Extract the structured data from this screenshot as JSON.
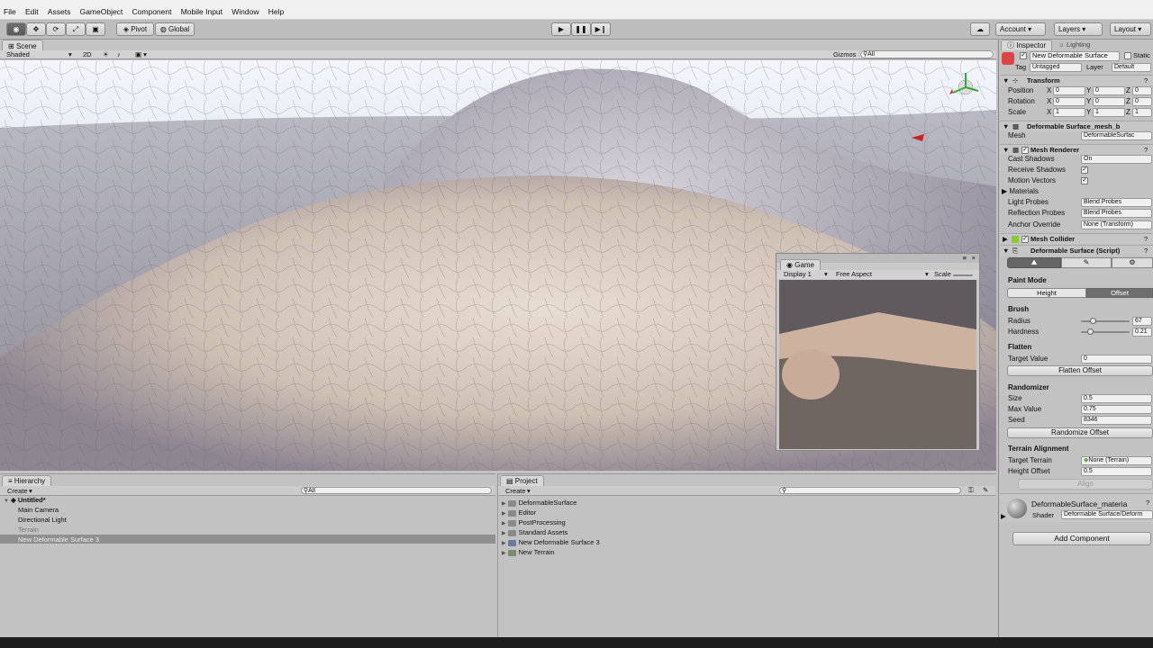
{
  "menu": [
    "File",
    "Edit",
    "Assets",
    "GameObject",
    "Component",
    "Mobile Input",
    "Window",
    "Help"
  ],
  "toolbar": {
    "pivot": "Pivot",
    "global": "Global",
    "account": "Account",
    "layers": "Layers",
    "layout": "Layout"
  },
  "scene": {
    "tab": "Scene",
    "shading": "Shaded",
    "mode2d": "2D",
    "gizmos": "Gizmos",
    "search_placeholder": "All"
  },
  "game": {
    "tab": "Game",
    "display": "Display 1",
    "aspect": "Free Aspect",
    "scale": "Scale"
  },
  "hierarchy": {
    "tab": "Hierarchy",
    "create": "Create",
    "search_placeholder": "All",
    "scene_name": "Untitled*",
    "items": [
      "Main Camera",
      "Directional Light",
      "Terrain",
      "New Deformable Surface 3"
    ]
  },
  "project": {
    "tab": "Project",
    "create": "Create",
    "items": [
      "DeformableSurface",
      "Editor",
      "PostProcessing",
      "Standard Assets",
      "New Deformable Surface 3",
      "New Terrain"
    ]
  },
  "inspector": {
    "tab": "Inspector",
    "tab2": "Lighting",
    "object_name": "New Deformable Surface",
    "static": "Static",
    "tag_label": "Tag",
    "tag_value": "Untagged",
    "layer_label": "Layer",
    "layer_value": "Default",
    "transform": {
      "title": "Transform",
      "position": "Position",
      "rotation": "Rotation",
      "scale": "Scale",
      "x": "X",
      "y": "Y",
      "z": "Z",
      "pos": [
        "0",
        "0",
        "0"
      ],
      "rot": [
        "0",
        "0",
        "0"
      ],
      "scl": [
        "1",
        "1",
        "1"
      ]
    },
    "meshfilter": {
      "title": "Deformable Surface_mesh_b",
      "mesh_label": "Mesh",
      "mesh_value": "DeformableSurfac"
    },
    "renderer": {
      "title": "Mesh Renderer",
      "cast": "Cast Shadows",
      "cast_value": "On",
      "receive": "Receive Shadows",
      "motion": "Motion Vectors",
      "materials": "Materials",
      "probes": "Light Probes",
      "probes_value": "Blend Probes",
      "refl": "Reflection Probes",
      "refl_value": "Blend Probes",
      "anchor": "Anchor Override",
      "anchor_value": "None (Transform)"
    },
    "collider": {
      "title": "Mesh Collider"
    },
    "script": {
      "title": "Deformable Surface (Script)",
      "paint_mode": "Paint Mode",
      "height": "Height",
      "offset": "Offset",
      "brush": "Brush",
      "radius": "Radius",
      "radius_value": "67",
      "radius_level": 0.25,
      "hardness": "Hardness",
      "hardness_value": "0.21",
      "hardness_level": 0.21,
      "flatten": "Flatten",
      "target_value": "Target Value",
      "target_value_value": "0",
      "flatten_offset": "Flatten Offset",
      "randomizer": "Randomizer",
      "size": "Size",
      "size_value": "0.5",
      "max_value": "Max Value",
      "max_value_value": "0.75",
      "seed": "Seed",
      "seed_value": "8346",
      "randomize_offset": "Randomize Offset",
      "terrain_alignment": "Terrain Alignment",
      "target_terrain": "Target Terrain",
      "target_terrain_value": "None (Terrain)",
      "height_offset": "Height Offset",
      "height_offset_value": "0.5",
      "align": "Align"
    },
    "material": {
      "name": "DeformableSurface_materia",
      "shader_label": "Shader",
      "shader_value": "Deformable Surface/Deform"
    },
    "add_component": "Add Component"
  },
  "colors": {
    "play_accent": "#1f1f1f",
    "selection": "#8f8f8f",
    "sky": "#c8d0e8"
  }
}
